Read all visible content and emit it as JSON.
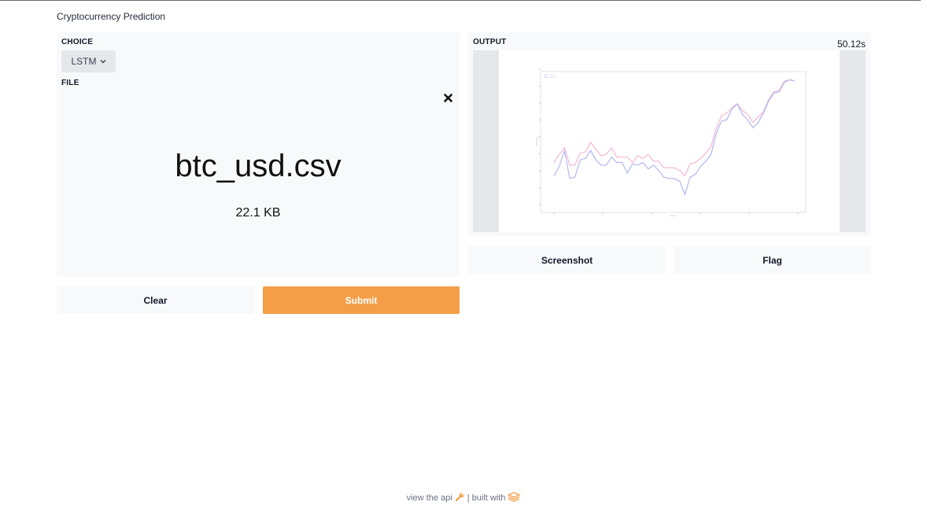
{
  "page": {
    "title": "Cryptocurrency Prediction"
  },
  "inputs": {
    "choice_label": "CHOICE",
    "choice_value": "LSTM",
    "file_label": "FILE",
    "file_name": "btc_usd.csv",
    "file_size": "22.1 KB",
    "clear_label": "Clear",
    "submit_label": "Submit"
  },
  "outputs": {
    "output_label": "OUTPUT",
    "elapsed_time": "50.12s",
    "screenshot_label": "Screenshot",
    "flag_label": "Flag"
  },
  "footer": {
    "api_text": "view the api",
    "built_with_text": "| built with"
  },
  "colors": {
    "accent": "#f49f48",
    "panel_background": "#f8f9fa",
    "series_pink": "#f3b6d4",
    "series_blue": "#b2b6f0"
  },
  "icons": {
    "dropdown": "chevron-down-icon",
    "remove_file": "close-icon",
    "api": "wrench-icon",
    "built_with": "gradio-logo-icon"
  },
  "chart_data": {
    "type": "line",
    "title": "",
    "xlabel": "",
    "ylabel": "",
    "grid": false,
    "legend": "top-left",
    "x": [
      0,
      1,
      2,
      3,
      4,
      5,
      6,
      7,
      8,
      9,
      10,
      11,
      12,
      13,
      14,
      15,
      16,
      17,
      18,
      19,
      20,
      21,
      22,
      23,
      24,
      25,
      26,
      27,
      28,
      29,
      30,
      31,
      32,
      33,
      34,
      35,
      36,
      37,
      38,
      39,
      40,
      41,
      42,
      43,
      44,
      45,
      46
    ],
    "series": [
      {
        "values": [
          46,
          52,
          57,
          44,
          44,
          53,
          54,
          61,
          56,
          51,
          52,
          57,
          50,
          50,
          50,
          46,
          51,
          49,
          52,
          47,
          47,
          42,
          42,
          42,
          40,
          36,
          45,
          46,
          49,
          53,
          58,
          72,
          81,
          83,
          87,
          90,
          85,
          82,
          76,
          80,
          84,
          93,
          99,
          100,
          107,
          108,
          107
        ]
      },
      {
        "values": [
          36,
          43,
          55,
          34,
          35,
          48,
          49,
          55,
          48,
          44,
          44,
          50,
          46,
          46,
          38,
          45,
          44,
          46,
          41,
          44,
          40,
          35,
          34,
          34,
          32,
          22,
          35,
          37,
          43,
          47,
          52,
          68,
          77,
          78,
          86,
          90,
          82,
          78,
          72,
          76,
          83,
          92,
          98,
          99,
          106,
          108,
          107
        ]
      }
    ]
  }
}
